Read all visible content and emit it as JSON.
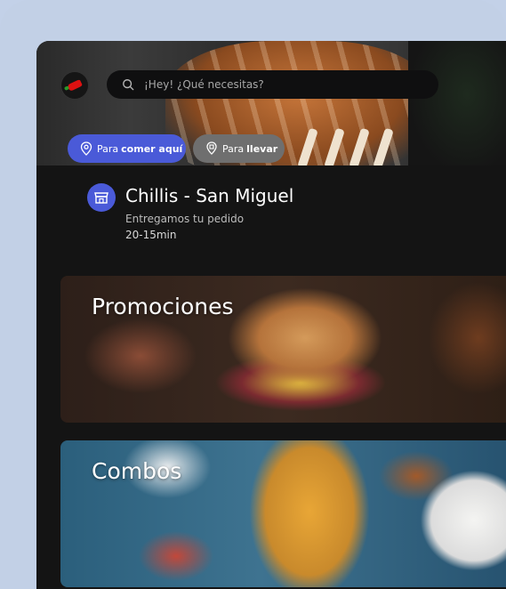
{
  "header": {
    "search_placeholder": "¡Hey! ¿Qué necesitas?",
    "brand_color": "#4a5ad8"
  },
  "order_modes": [
    {
      "prefix": "Para",
      "label": "comer aquí",
      "icon": "location-pin-icon",
      "selected": true
    },
    {
      "prefix": "Para",
      "label": "llevar",
      "icon": "takeaway-icon",
      "selected": false
    }
  ],
  "store": {
    "name": "Chillis - San Miguel",
    "subtitle": "Entregamos tu pedido",
    "time": "20-15min",
    "icon": "store-icon"
  },
  "categories": [
    {
      "label": "Promociones"
    },
    {
      "label": "Combos"
    }
  ]
}
